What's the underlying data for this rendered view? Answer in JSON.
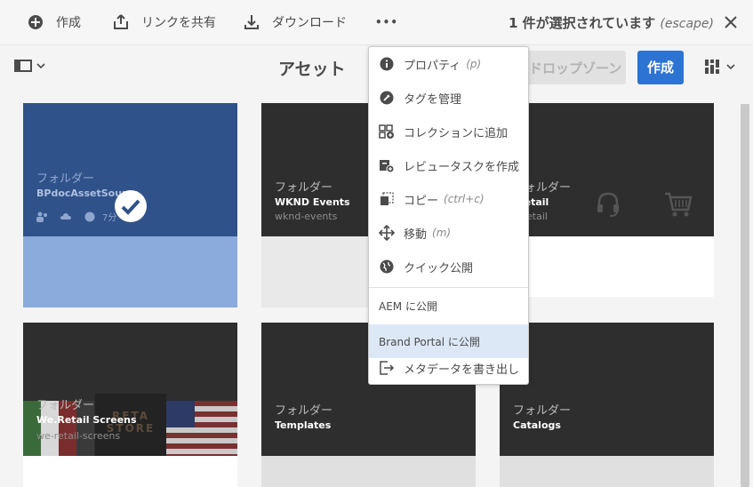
{
  "actionbar": {
    "create_label": "作成",
    "share_link_label": "リンクを共有",
    "download_label": "ダウンロード",
    "more_label": "•••",
    "selection_text": "1 件が選択されています",
    "escape_hint": "(escape)"
  },
  "titlebar": {
    "title": "アセット",
    "dropzone_label": "ドロップゾーン",
    "create_label": "作成"
  },
  "cards": [
    {
      "kind": "フォルダー",
      "name": "BPdocAssetSource",
      "slug": "",
      "meta": "7分"
    },
    {
      "kind": "フォルダー",
      "name": "WKND Events",
      "slug": "wknd-events"
    },
    {
      "kind": "フォルダー",
      "name": ".Retail",
      "slug": "e-retail"
    },
    {
      "kind": "フォルダー",
      "name": "We.Retail Screens",
      "slug": "we-retail-screens"
    },
    {
      "kind": "フォルダー",
      "name": "Templates",
      "slug": ""
    },
    {
      "kind": "フォルダー",
      "name": "Catalogs",
      "slug": ""
    }
  ],
  "menu": {
    "items": [
      {
        "label": "プロパティ",
        "shortcut": "(p)",
        "icon": "info-icon"
      },
      {
        "label": "タグを管理",
        "shortcut": "",
        "icon": "tag-icon"
      },
      {
        "label": "コレクションに追加",
        "shortcut": "",
        "icon": "collection-add-icon"
      },
      {
        "label": "レビュータスクを作成",
        "shortcut": "",
        "icon": "task-add-icon"
      },
      {
        "label": "コピー",
        "shortcut": "(ctrl+c)",
        "icon": "copy-icon"
      },
      {
        "label": "移動",
        "shortcut": "(m)",
        "icon": "move-icon"
      },
      {
        "label": "クイック公開",
        "shortcut": "",
        "icon": "globe-icon"
      },
      {
        "label": "AEM に公開",
        "shortcut": "",
        "icon": ""
      },
      {
        "label": "Brand Portal に公開",
        "shortcut": "",
        "icon": ""
      },
      {
        "label": "メタデータを書き出し",
        "shortcut": "",
        "icon": "export-icon"
      }
    ]
  },
  "colors": {
    "accent": "#2d73d2",
    "selected_card": "#30528a",
    "selected_card_footer": "#8aabdb",
    "menu_highlight": "#dde8f7"
  }
}
